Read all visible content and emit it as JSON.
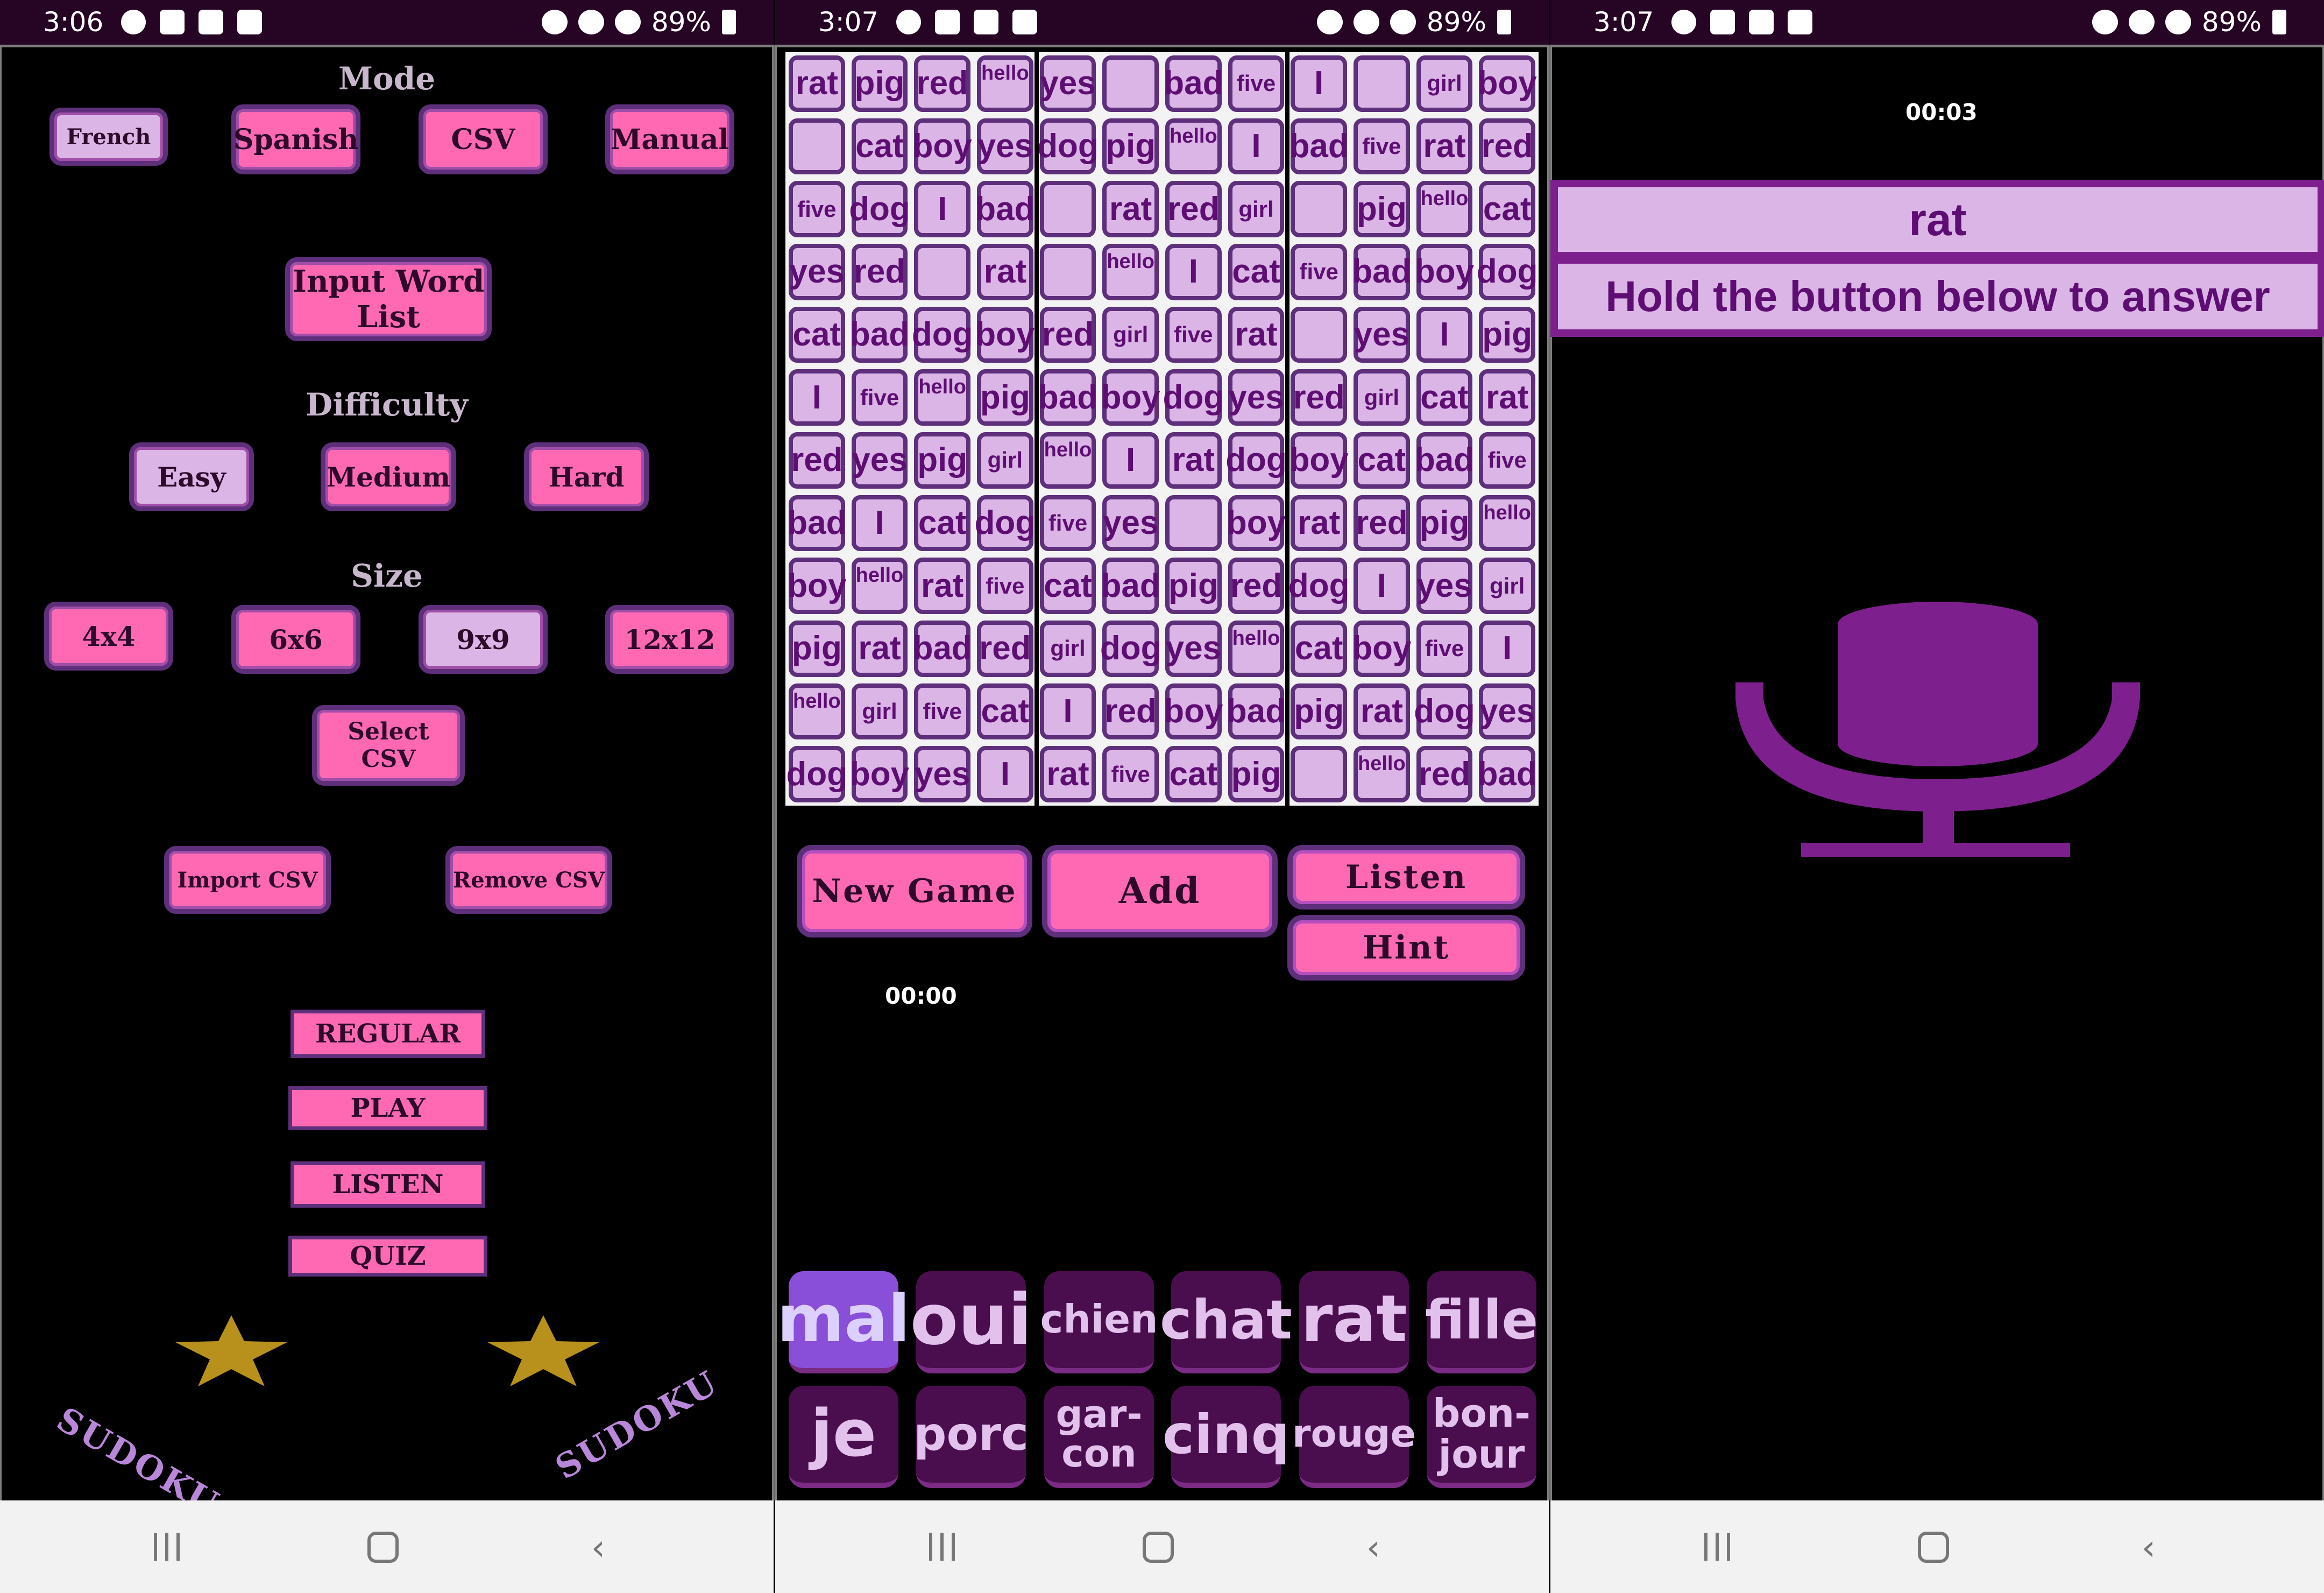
{
  "screens": [
    {
      "status": {
        "time": "3:06",
        "battery": "89%"
      },
      "mode": {
        "label": "Mode",
        "options": [
          "French",
          "Spanish",
          "CSV",
          "Manual"
        ]
      },
      "input_word_list": "Input Word List",
      "difficulty": {
        "label": "Difficulty",
        "options": [
          "Easy",
          "Medium",
          "Hard"
        ]
      },
      "size": {
        "label": "Size",
        "options": [
          "4x4",
          "6x6",
          "9x9",
          "12x12"
        ]
      },
      "select_csv": "Select CSV",
      "import_csv": "Import CSV",
      "remove_csv": "Remove CSV",
      "game_modes": [
        "REGULAR",
        "PLAY",
        "LISTEN",
        "QUIZ"
      ],
      "brand": "SUDOKU"
    },
    {
      "status": {
        "time": "3:07",
        "battery": "89%"
      },
      "grid": [
        [
          "rat",
          "pig",
          "red",
          "hello",
          "yes",
          "",
          "bad",
          "five",
          "I",
          "",
          "girl",
          "boy"
        ],
        [
          "",
          "cat",
          "boy",
          "yes",
          "dog",
          "pig",
          "hello",
          "I",
          "bad",
          "five",
          "rat",
          "red"
        ],
        [
          "five",
          "dog",
          "I",
          "bad",
          "",
          "rat",
          "red",
          "girl",
          "",
          "pig",
          "hello",
          "cat"
        ],
        [
          "yes",
          "red",
          "",
          "rat",
          "",
          "hello",
          "I",
          "cat",
          "five",
          "bad",
          "boy",
          "dog"
        ],
        [
          "cat",
          "bad",
          "dog",
          "boy",
          "red",
          "girl",
          "five",
          "rat",
          "",
          "yes",
          "I",
          "pig"
        ],
        [
          "I",
          "five",
          "hello",
          "pig",
          "bad",
          "boy",
          "dog",
          "yes",
          "red",
          "girl",
          "cat",
          "rat"
        ],
        [
          "red",
          "yes",
          "pig",
          "girl",
          "hello",
          "I",
          "rat",
          "dog",
          "boy",
          "cat",
          "bad",
          "five"
        ],
        [
          "bad",
          "I",
          "cat",
          "dog",
          "five",
          "yes",
          "",
          "boy",
          "rat",
          "red",
          "pig",
          "hello"
        ],
        [
          "boy",
          "hello",
          "rat",
          "five",
          "cat",
          "bad",
          "pig",
          "red",
          "dog",
          "I",
          "yes",
          "girl"
        ],
        [
          "pig",
          "rat",
          "bad",
          "red",
          "girl",
          "dog",
          "yes",
          "hello",
          "cat",
          "boy",
          "five",
          "I"
        ],
        [
          "hello",
          "girl",
          "five",
          "cat",
          "I",
          "red",
          "boy",
          "bad",
          "pig",
          "rat",
          "dog",
          "yes"
        ],
        [
          "dog",
          "boy",
          "yes",
          "I",
          "rat",
          "five",
          "cat",
          "pig",
          "",
          "hello",
          "red",
          "bad"
        ]
      ],
      "buttons": {
        "new_game": "New Game",
        "add": "Add",
        "listen": "Listen",
        "hint": "Hint"
      },
      "timer": "00:00",
      "word_bank": [
        "mal",
        "oui",
        "chien",
        "chat",
        "rat",
        "fille",
        "je",
        "porc",
        "gar-con",
        "cinq",
        "rouge",
        "bon-jour"
      ]
    },
    {
      "status": {
        "time": "3:07",
        "battery": "89%"
      },
      "timer": "00:03",
      "prompt_word": "rat",
      "instruction": "Hold the button below to answer",
      "mic_icon": "microphone-icon"
    }
  ],
  "colors": {
    "pink": "#ff69b4",
    "lilac": "#dbb5e6",
    "purple": "#5e2f7a",
    "dark_purple": "#4a0d4e",
    "accent": "#8a4fd8"
  }
}
